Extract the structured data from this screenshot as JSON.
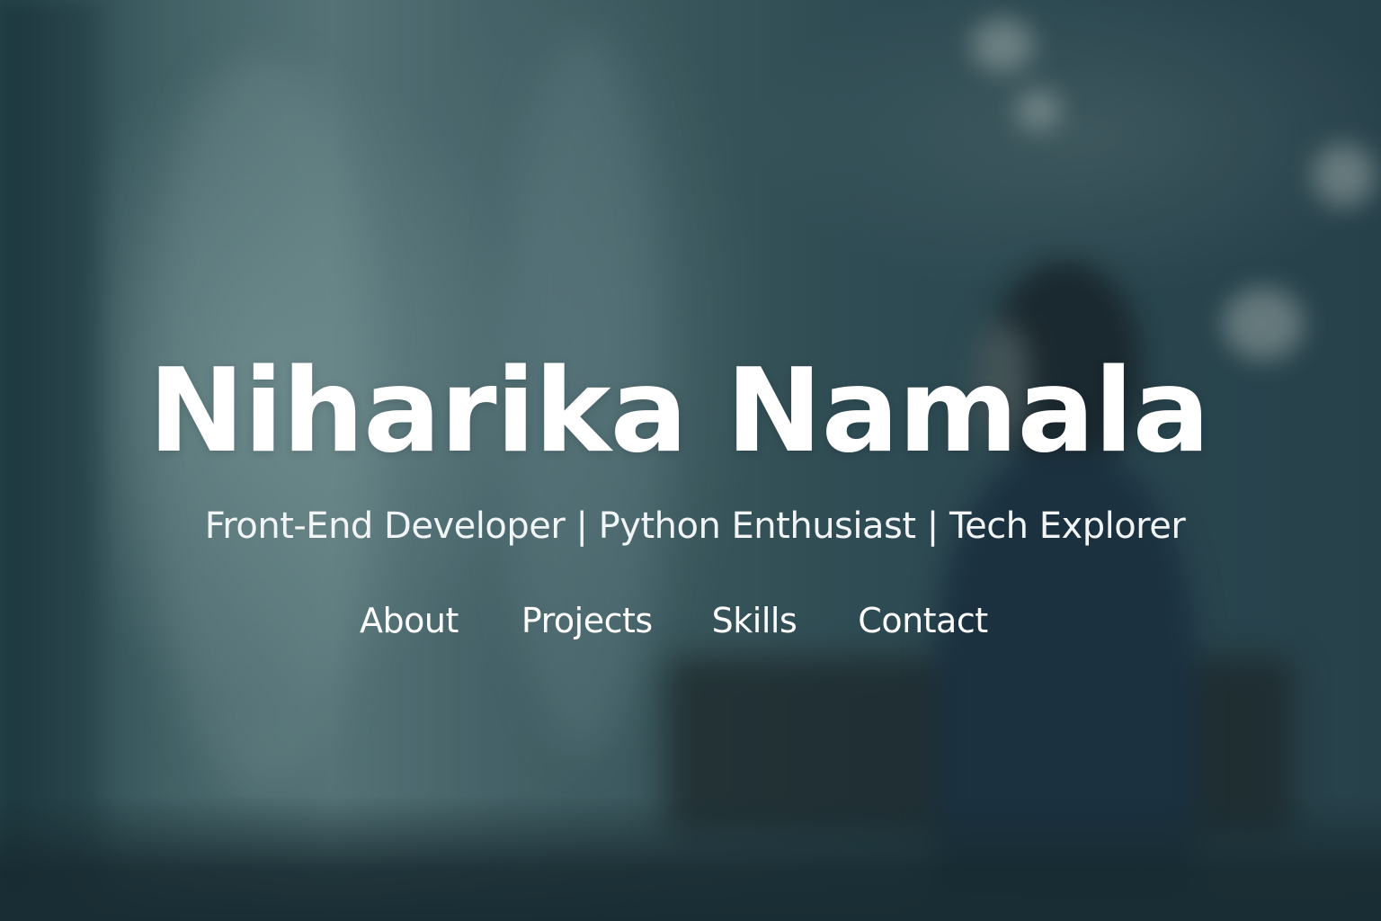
{
  "hero": {
    "name": "Niharika Namala",
    "tagline": "Front-End Developer | Python Enthusiast | Tech Explorer"
  },
  "nav": {
    "items": [
      {
        "label": "About"
      },
      {
        "label": "Projects"
      },
      {
        "label": "Skills"
      },
      {
        "label": "Contact"
      }
    ]
  },
  "colors": {
    "text": "#ffffff",
    "background_tint": "#3e5d62"
  }
}
